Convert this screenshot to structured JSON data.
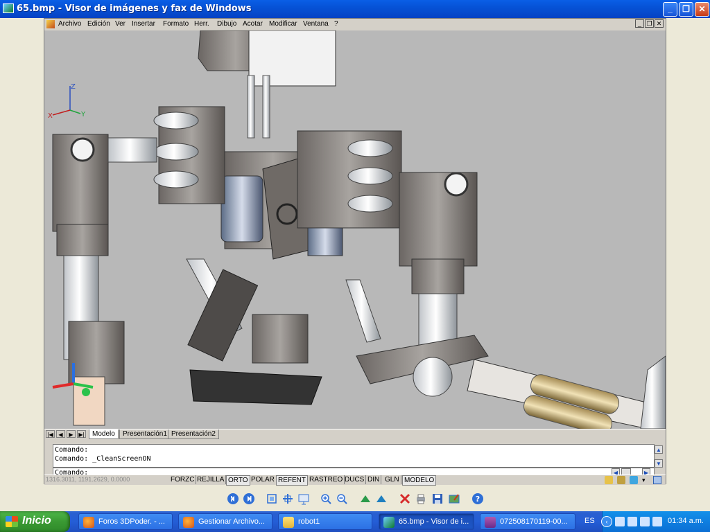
{
  "window": {
    "title": "65.bmp - Visor de imágenes y fax de Windows"
  },
  "cad": {
    "menu": [
      "Archivo",
      "Edición",
      "Ver",
      "Insertar",
      "Formato",
      "Herr.",
      "Dibujo",
      "Acotar",
      "Modificar",
      "Ventana",
      "?"
    ],
    "tabs": [
      "Modelo",
      "Presentación1",
      "Presentación2"
    ],
    "active_tab": "Modelo",
    "command_history": [
      "Comando:",
      "Comando:  _CleanScreenON"
    ],
    "command_prompt": "Comando:",
    "coords": "1316.3011, 1191.2629, 0.0000",
    "status_toggles": [
      "FORZC",
      "REJILLA",
      "ORTO",
      "POLAR",
      "REFENT",
      "RASTREO",
      "DUCS",
      "DIN",
      "GLN",
      "MODELO"
    ],
    "axis_labels": {
      "x": "X",
      "y": "Y",
      "z": "Z"
    }
  },
  "taskbar": {
    "start_label": "Inicio",
    "tasks": [
      {
        "label": "Foros 3DPoder. - ...",
        "icon": "firefox-icon"
      },
      {
        "label": "Gestionar Archivo...",
        "icon": "firefox-icon"
      },
      {
        "label": "robot1",
        "icon": "folder-icon"
      },
      {
        "label": "65.bmp - Visor de i...",
        "icon": "image-viewer-icon"
      },
      {
        "label": "072508170119-00...",
        "icon": "winrar-icon"
      }
    ],
    "active_task": 3,
    "language": "ES",
    "clock": "01:34 a.m."
  },
  "colors": {
    "titlebar": "#0652d6",
    "taskbar": "#245ed6",
    "start": "#3a9a33",
    "viewport_bg": "#b8b8b8"
  }
}
